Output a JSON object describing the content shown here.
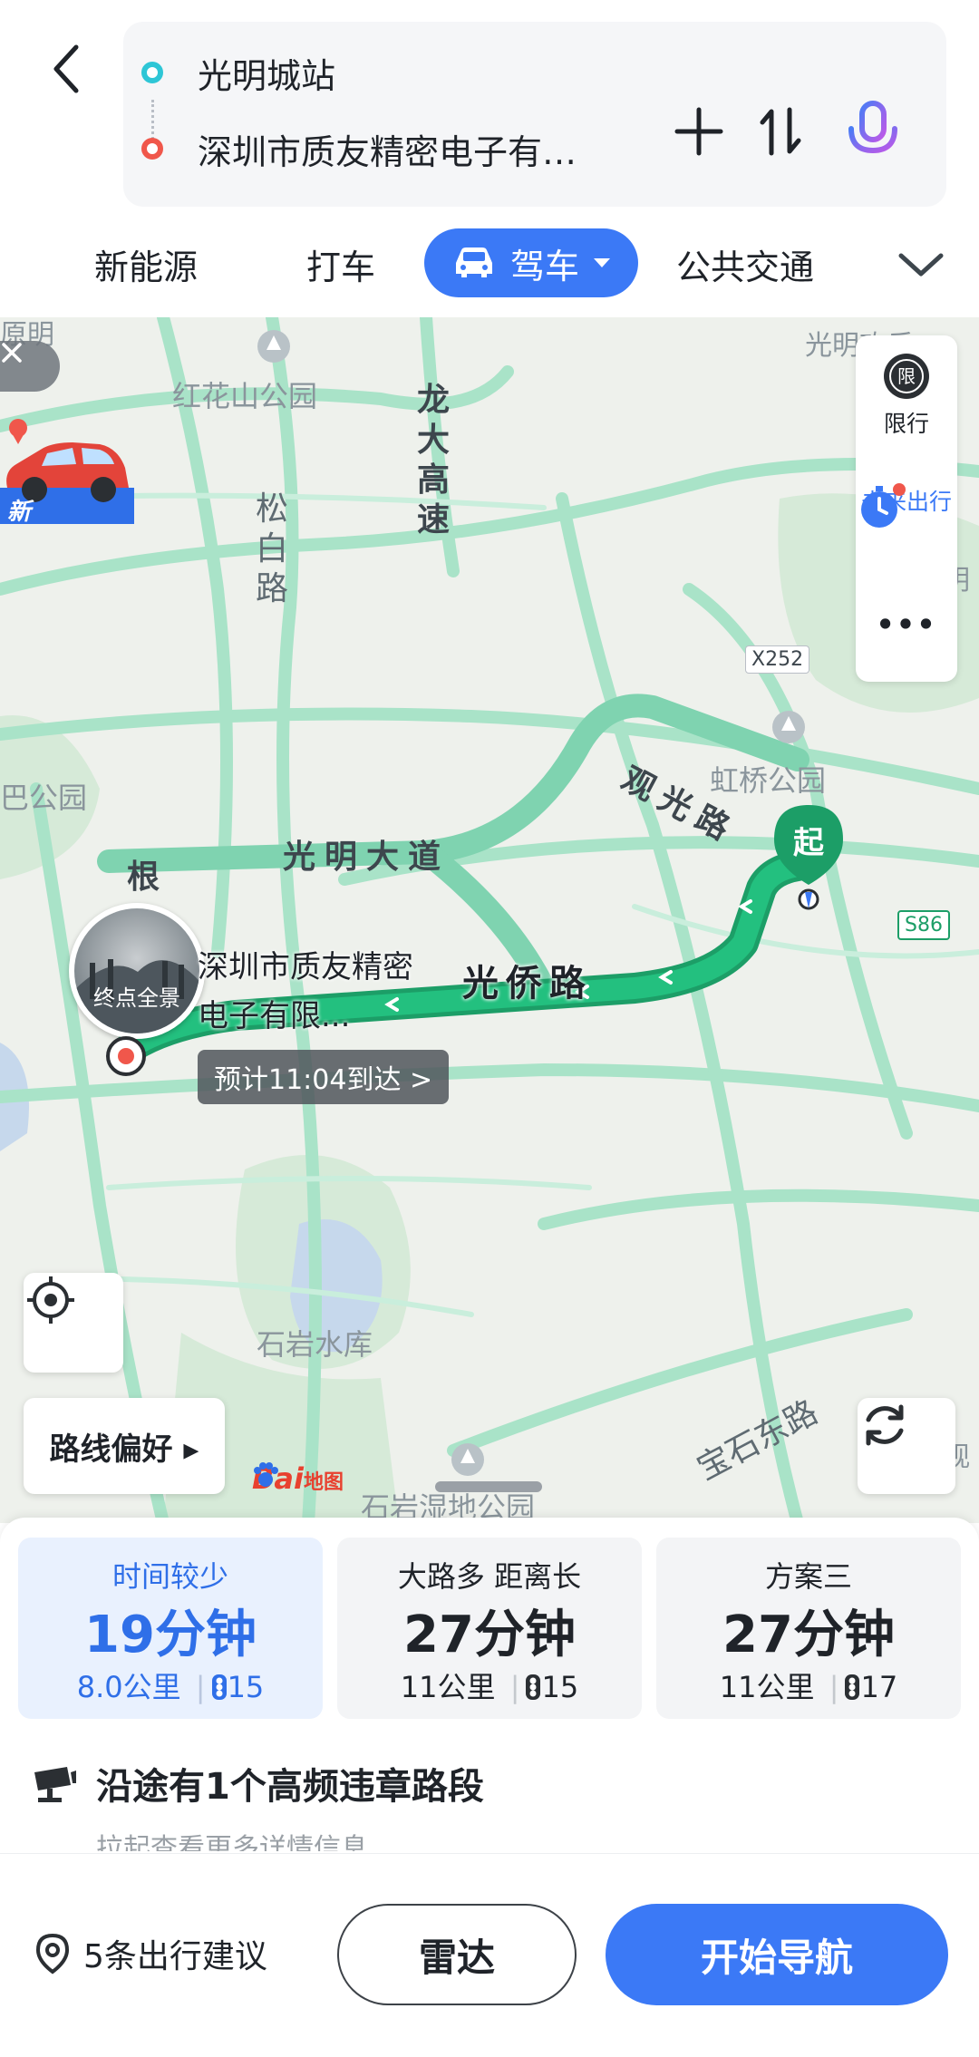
{
  "header": {
    "start": "光明城站",
    "end": "深圳市质友精密电子有…"
  },
  "tabs": {
    "items": [
      "新能源",
      "打车",
      "公共交通"
    ],
    "active": "驾车"
  },
  "map": {
    "labels": {
      "hongfa_park": "红花山公园",
      "longda": "龙大高速",
      "songbai": "松白路",
      "guangming_dadao": "光明大道",
      "guanguang": "观光路",
      "guangqiao": "光侨路",
      "hongqiao_park": "虹桥公园",
      "shiyan": "石岩水库",
      "shiyan_wetland": "石岩湿地公园",
      "baoshi_east": "宝石东路",
      "x252": "X252",
      "s86": "S86",
      "gen": "根",
      "bagongyuan": "巴公园",
      "guangming_top": "光明欢乐",
      "top_left": "原明",
      "right_edge": "明",
      "right_edge2": "观"
    },
    "new_badge": "新",
    "side_panel": {
      "restrict": "限行",
      "restrict_icon": "限",
      "future": "未来出行",
      "more": "•••"
    },
    "destination": {
      "thumb_label": "终点全景",
      "name": "深圳市质友精密电子有限...",
      "eta": "预计11:04到达 >"
    },
    "start_pin": "起",
    "route_pref": "路线偏好 ▸",
    "baidu": {
      "bai": "Bai",
      "du": "地图"
    },
    "colors": {
      "route": "#1fb87a",
      "alt_route": "#7fd3b0",
      "road": "#a9e3c8",
      "water": "#c6d8ec",
      "park": "#d6ead8"
    }
  },
  "routes": [
    {
      "title": "时间较少",
      "time": "19分钟",
      "distance": "8.0公里",
      "lights": "15"
    },
    {
      "title": "大路多 距离长",
      "time": "27分钟",
      "distance": "11公里",
      "lights": "15"
    },
    {
      "title": "方案三",
      "time": "27分钟",
      "distance": "11公里",
      "lights": "17"
    }
  ],
  "violation": {
    "text": "沿途有1个高频违章路段",
    "sub": "拉起查看更多详情信息"
  },
  "bottom": {
    "suggest": "5条出行建议",
    "radar": "雷达",
    "navigate": "开始导航"
  }
}
